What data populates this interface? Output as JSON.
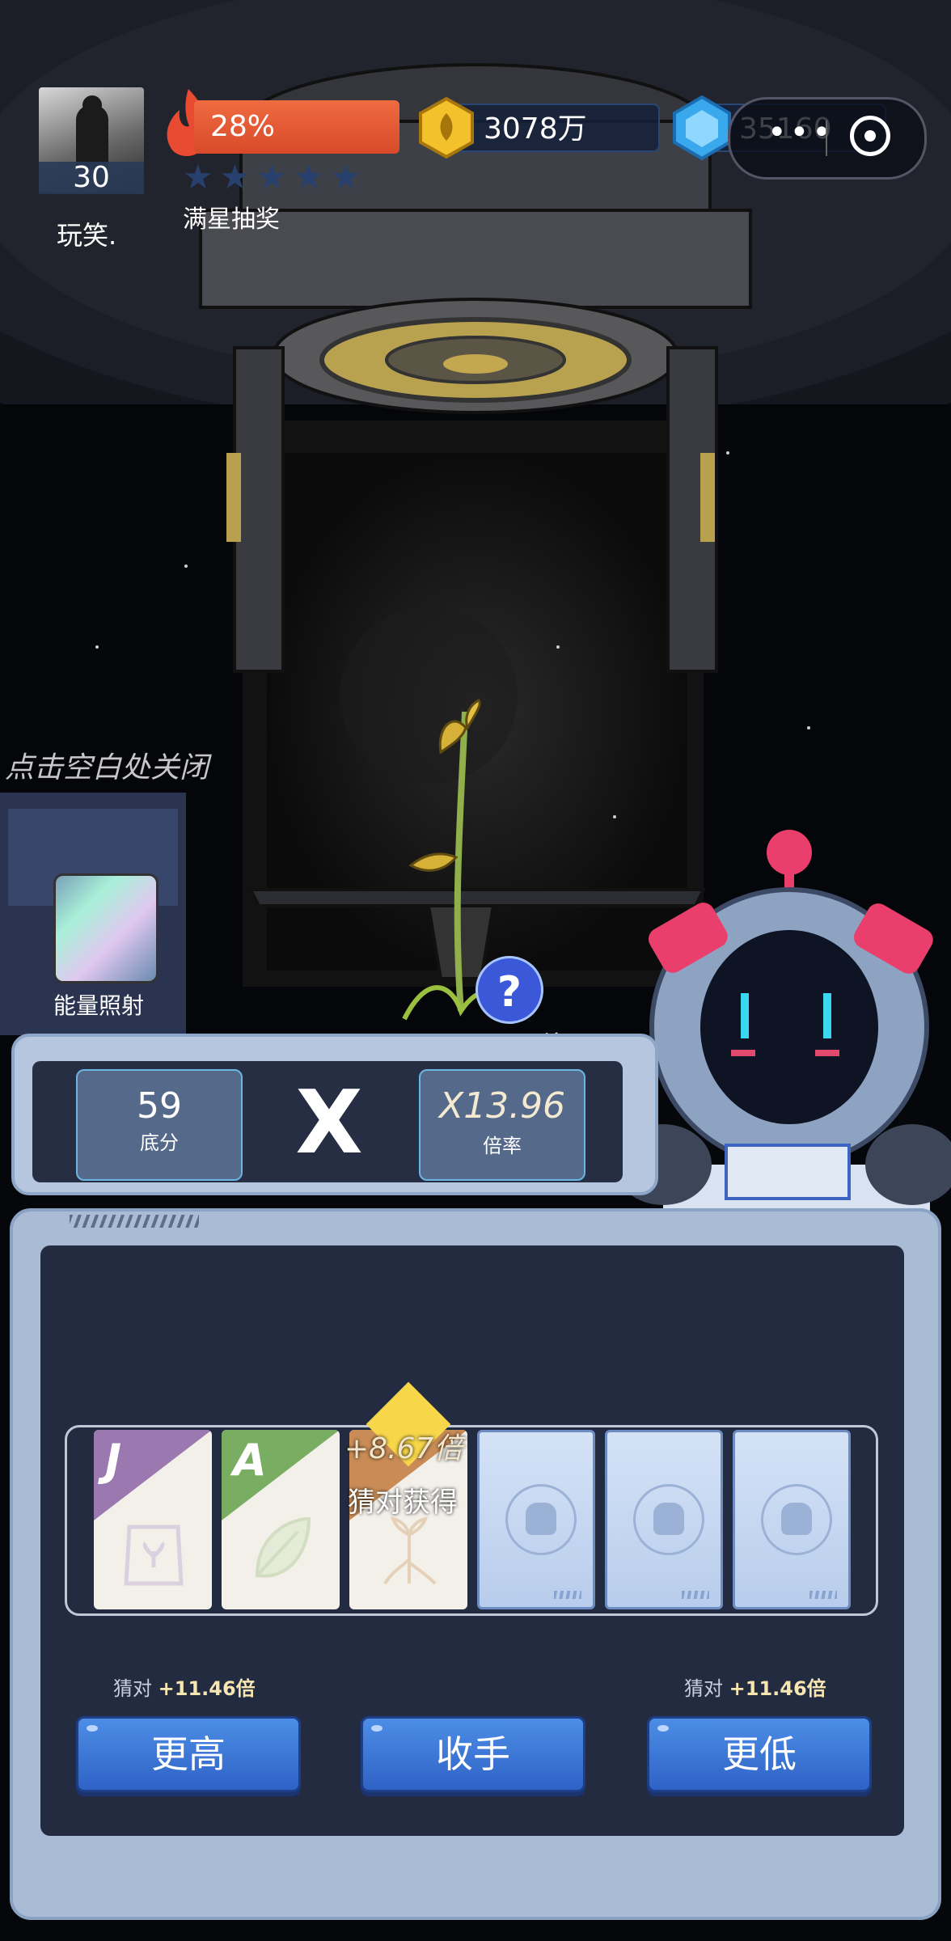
{
  "player": {
    "level": "30",
    "name": "玩笑."
  },
  "star_progress": {
    "percent_label": "28%",
    "caption": "满星抽奖"
  },
  "currency": {
    "gold": "3078万",
    "gems": "35160"
  },
  "close_hint": "点击空白处关闭",
  "energy": {
    "label": "能量照射"
  },
  "plant": {
    "bonus": "+8.67倍",
    "question": "?"
  },
  "score_panel": {
    "base_score": "59",
    "base_label": "底分",
    "operator": "X",
    "rate": "X13.96",
    "rate_label": "倍率"
  },
  "cards": [
    {
      "rank": "J",
      "color": "#9b78b0",
      "icon": "seed-bag-icon"
    },
    {
      "rank": "A",
      "color": "#79ad62",
      "icon": "leaf-icon"
    },
    {
      "rank": "",
      "color": "#c98c56",
      "icon": "sprout-icon"
    },
    {
      "rank": "",
      "face_down": true,
      "icon": "robot-emblem-icon"
    },
    {
      "rank": "",
      "face_down": true,
      "icon": "robot-emblem-icon"
    },
    {
      "rank": "",
      "face_down": true,
      "icon": "robot-emblem-icon"
    }
  ],
  "current_bonus": {
    "value": "+8.67倍",
    "text": "猜对获得"
  },
  "guess_hints": {
    "higher": {
      "prefix": "猜对",
      "value": "+11.46倍"
    },
    "lower": {
      "prefix": "猜对",
      "value": "+11.46倍"
    }
  },
  "buttons": {
    "higher": "更高",
    "stop": "收手",
    "lower": "更低"
  }
}
